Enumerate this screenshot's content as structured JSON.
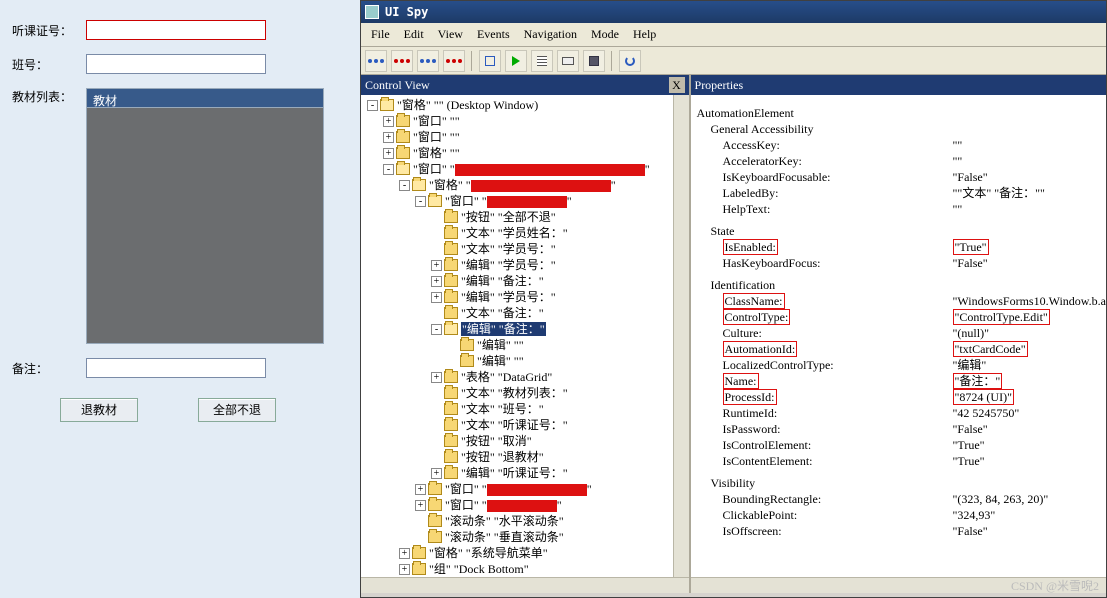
{
  "form": {
    "labels": {
      "cardno": "听课证号：",
      "classno": "班号：",
      "matlist": "教材列表：",
      "remark": "备注："
    },
    "mat_header": "教材",
    "cardno_value": "",
    "classno_value": "",
    "remark_value": "",
    "buttons": {
      "return_mat": "退教材",
      "no_return_all": "全部不退"
    }
  },
  "uispy": {
    "title": "UI Spy",
    "menus": [
      "File",
      "Edit",
      "View",
      "Events",
      "Navigation",
      "Mode",
      "Help"
    ],
    "pane_tree_title": "Control View",
    "pane_prop_title": "Properties",
    "close_x": "X",
    "toolbar_icons": [
      "dots-b",
      "dots-r",
      "dots-b2",
      "dots-r2",
      "rect",
      "play",
      "list",
      "kb",
      "disk",
      "sep",
      "ref"
    ]
  },
  "tree": [
    {
      "d": 0,
      "e": "-",
      "t": [
        "\"窗格\" \"\" (Desktop Window)"
      ]
    },
    {
      "d": 1,
      "e": "+",
      "t": [
        "\"窗口\" \"\""
      ]
    },
    {
      "d": 1,
      "e": "+",
      "t": [
        "\"窗口\" \"\""
      ]
    },
    {
      "d": 1,
      "e": "+",
      "t": [
        "\"窗格\" \"\""
      ]
    },
    {
      "d": 1,
      "e": "-",
      "t": [
        "\"窗口\" \"",
        "RED:190",
        "\""
      ]
    },
    {
      "d": 2,
      "e": "-",
      "t": [
        "\"窗格\" \"",
        "RED:140",
        "\""
      ]
    },
    {
      "d": 3,
      "e": "-",
      "t": [
        "\"窗口\" \"",
        "RED:80",
        "\""
      ]
    },
    {
      "d": 4,
      "e": " ",
      "t": [
        "\"按钮\" \"全部不退\""
      ]
    },
    {
      "d": 4,
      "e": " ",
      "t": [
        "\"文本\" \"学员姓名：\""
      ]
    },
    {
      "d": 4,
      "e": " ",
      "t": [
        "\"文本\" \"学员号：\""
      ]
    },
    {
      "d": 4,
      "e": "+",
      "t": [
        "\"编辑\" \"学员号：\""
      ]
    },
    {
      "d": 4,
      "e": "+",
      "t": [
        "\"编辑\" \"备注：\""
      ]
    },
    {
      "d": 4,
      "e": "+",
      "t": [
        "\"编辑\" \"学员号：\""
      ]
    },
    {
      "d": 4,
      "e": " ",
      "t": [
        "\"文本\" \"备注：\""
      ]
    },
    {
      "d": 4,
      "e": "-",
      "t": [
        "SEL:\"编辑\" \"备注：\""
      ]
    },
    {
      "d": 5,
      "e": " ",
      "t": [
        "\"编辑\" \"\""
      ]
    },
    {
      "d": 5,
      "e": " ",
      "t": [
        "\"编辑\" \"\""
      ]
    },
    {
      "d": 4,
      "e": "+",
      "t": [
        "\"表格\" \"DataGrid\""
      ]
    },
    {
      "d": 4,
      "e": " ",
      "t": [
        "\"文本\" \"教材列表：\""
      ]
    },
    {
      "d": 4,
      "e": " ",
      "t": [
        "\"文本\" \"班号：\""
      ]
    },
    {
      "d": 4,
      "e": " ",
      "t": [
        "\"文本\" \"听课证号：\""
      ]
    },
    {
      "d": 4,
      "e": " ",
      "t": [
        "\"按钮\" \"取消\""
      ]
    },
    {
      "d": 4,
      "e": " ",
      "t": [
        "\"按钮\" \"退教材\""
      ]
    },
    {
      "d": 4,
      "e": "+",
      "t": [
        "\"编辑\" \"听课证号：\""
      ]
    },
    {
      "d": 3,
      "e": "+",
      "t": [
        "\"窗口\" \"",
        "RED:100",
        "\""
      ]
    },
    {
      "d": 3,
      "e": "+",
      "t": [
        "\"窗口\" \"",
        "RED:70",
        "\""
      ]
    },
    {
      "d": 3,
      "e": " ",
      "t": [
        "\"滚动条\" \"水平滚动条\""
      ]
    },
    {
      "d": 3,
      "e": " ",
      "t": [
        "\"滚动条\" \"垂直滚动条\""
      ]
    },
    {
      "d": 2,
      "e": "+",
      "t": [
        "\"窗格\" \"系统导航菜单\""
      ]
    },
    {
      "d": 2,
      "e": "+",
      "t": [
        "\"组\" \"Dock Bottom\""
      ]
    }
  ],
  "props": {
    "root": "AutomationElement",
    "sec1": "General Accessibility",
    "ga": [
      {
        "k": "AccessKey:",
        "v": "\"\""
      },
      {
        "k": "AcceleratorKey:",
        "v": "\"\""
      },
      {
        "k": "IsKeyboardFocusable:",
        "v": "\"False\""
      },
      {
        "k": "LabeledBy:",
        "v": "\"\"文本\" \"备注：\"\""
      },
      {
        "k": "HelpText:",
        "v": "\"\""
      }
    ],
    "sec2": "State",
    "st": [
      {
        "k": "IsEnabled:",
        "v": "\"True\"",
        "hl": true
      },
      {
        "k": "HasKeyboardFocus:",
        "v": "\"False\""
      }
    ],
    "sec3": "Identification",
    "id": [
      {
        "k": "ClassName:",
        "v": "\"WindowsForms10.Window.b.a",
        "hlk": true
      },
      {
        "k": "ControlType:",
        "v": "\"ControlType.Edit\"",
        "hlk": true,
        "hlv": true
      },
      {
        "k": "Culture:",
        "v": "\"(null)\""
      },
      {
        "k": "AutomationId:",
        "v": "\"txtCardCode\"",
        "hlk": true,
        "hlv": true
      },
      {
        "k": "LocalizedControlType:",
        "v": "\"编辑\""
      },
      {
        "k": "Name:",
        "v": "\"备注：\"",
        "hlk": true,
        "hlv": true
      },
      {
        "k": "ProcessId:",
        "v": "\"8724 (UI)\"",
        "hlk": true,
        "hlv": true
      },
      {
        "k": "RuntimeId:",
        "v": "\"42 5245750\""
      },
      {
        "k": "IsPassword:",
        "v": "\"False\""
      },
      {
        "k": "IsControlElement:",
        "v": "\"True\""
      },
      {
        "k": "IsContentElement:",
        "v": "\"True\""
      }
    ],
    "sec4": "Visibility",
    "vi": [
      {
        "k": "BoundingRectangle:",
        "v": "\"(323, 84, 263, 20)\""
      },
      {
        "k": "ClickablePoint:",
        "v": "\"324,93\""
      },
      {
        "k": "IsOffscreen:",
        "v": "\"False\""
      }
    ]
  },
  "watermark": "CSDN @米雪唲2"
}
